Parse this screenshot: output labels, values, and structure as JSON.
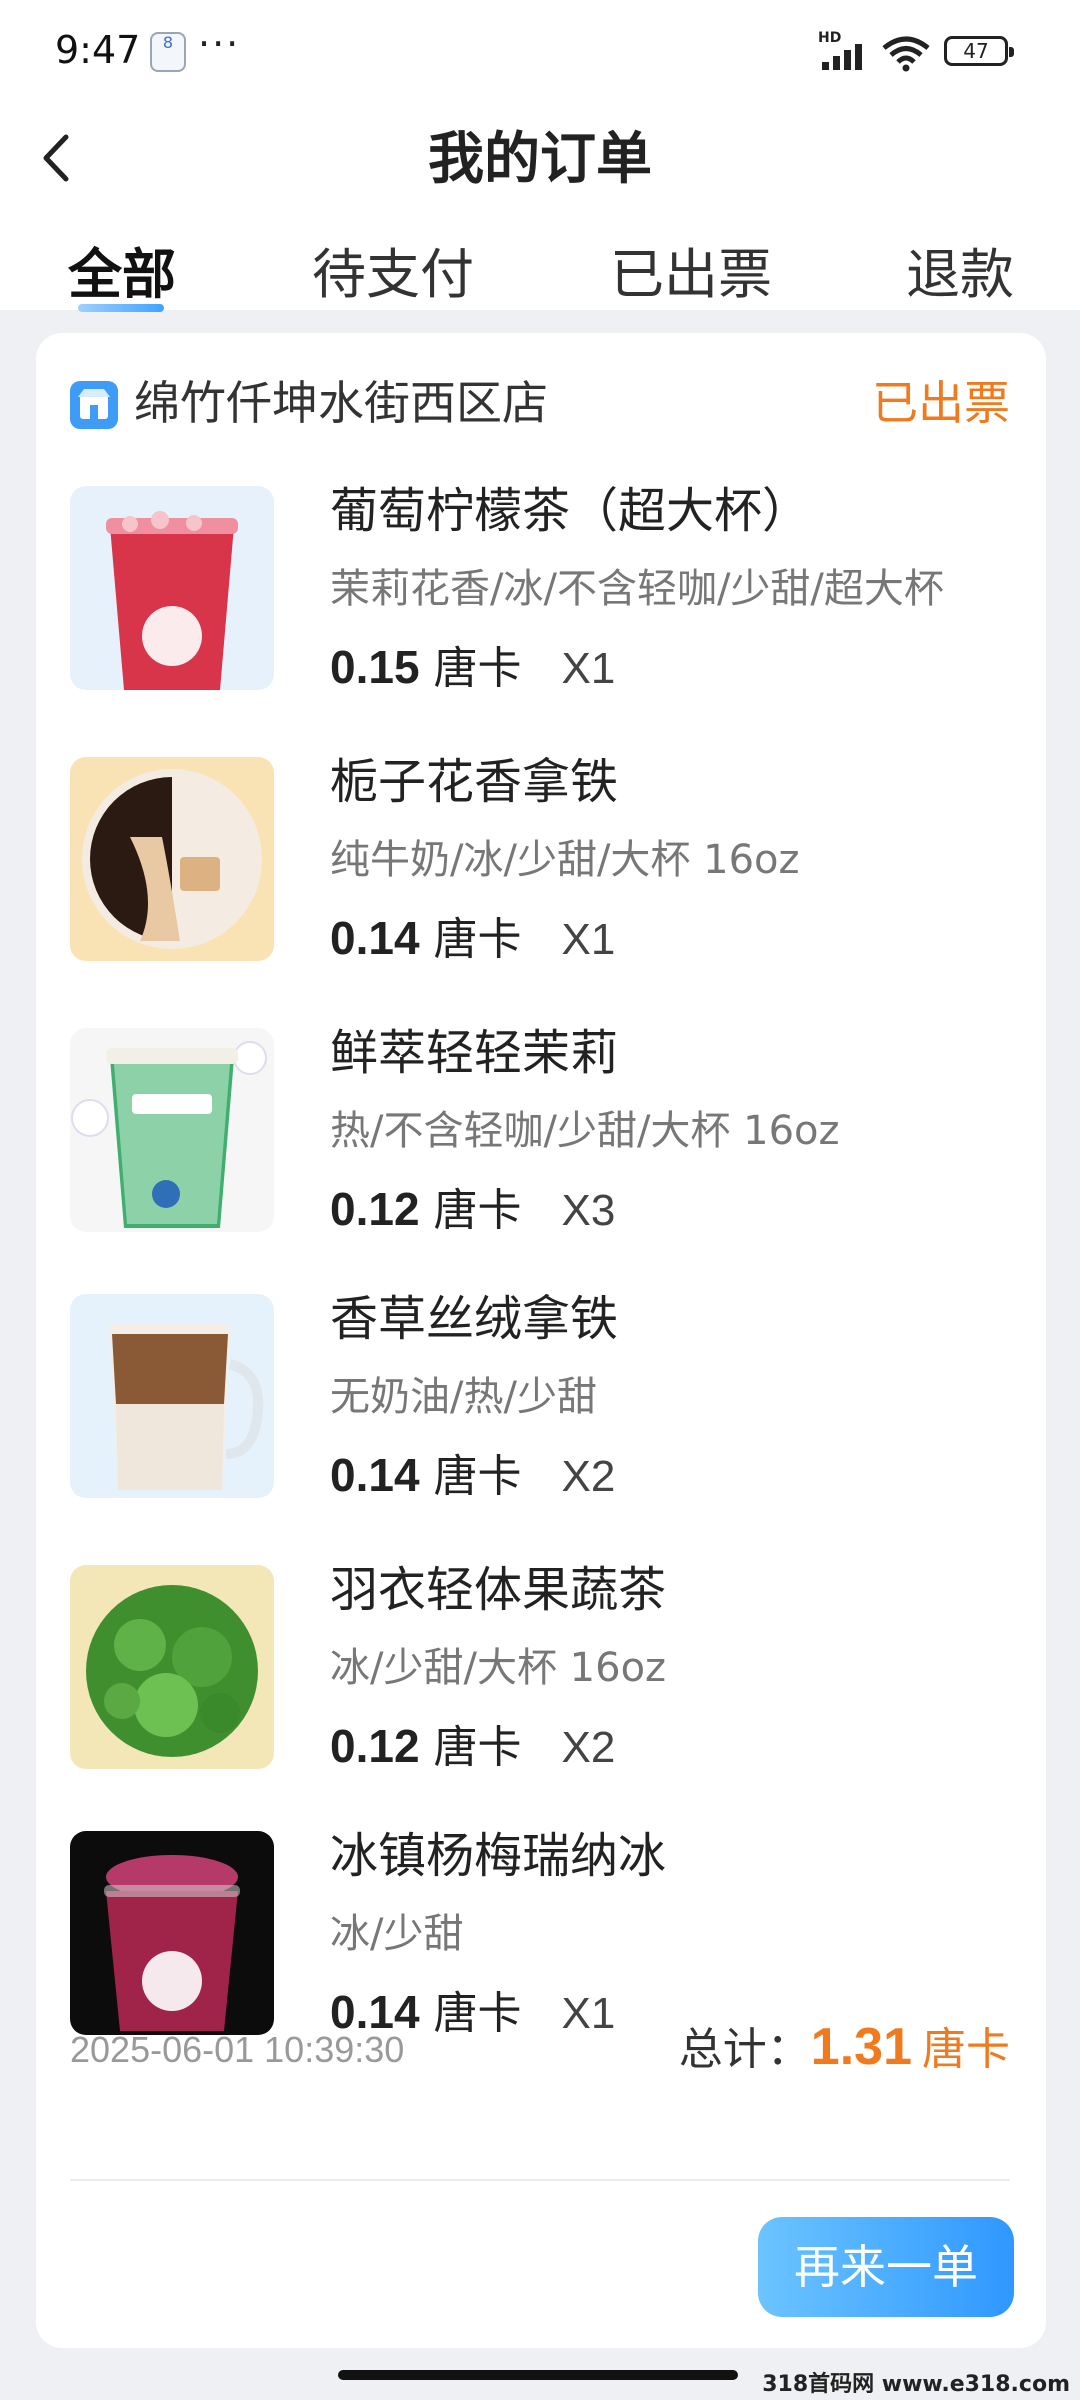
{
  "status_bar": {
    "time": "9:47",
    "notification_badge": "8",
    "more": "···",
    "network": "HD",
    "battery": "47"
  },
  "header": {
    "title": "我的订单"
  },
  "tabs": [
    {
      "label": "全部",
      "active": true
    },
    {
      "label": "待支付",
      "active": false
    },
    {
      "label": "已出票",
      "active": false
    },
    {
      "label": "退款",
      "active": false
    }
  ],
  "order": {
    "store_name": "绵竹仟坤水街西区店",
    "status": "已出票",
    "items": [
      {
        "name": "葡萄柠檬茶（超大杯）",
        "spec": "茉莉花香/冰/不含轻咖/少甜/超大杯",
        "price": "0.15",
        "unit": "唐卡",
        "qty": "X1"
      },
      {
        "name": "栀子花香拿铁",
        "spec": "纯牛奶/冰/少甜/大杯 16oz",
        "price": "0.14",
        "unit": "唐卡",
        "qty": "X1"
      },
      {
        "name": "鲜萃轻轻茉莉",
        "spec": "热/不含轻咖/少甜/大杯 16oz",
        "price": "0.12",
        "unit": "唐卡",
        "qty": "X3"
      },
      {
        "name": "香草丝绒拿铁",
        "spec": "无奶油/热/少甜",
        "price": "0.14",
        "unit": "唐卡",
        "qty": "X2"
      },
      {
        "name": "羽衣轻体果蔬茶",
        "spec": "冰/少甜/大杯 16oz",
        "price": "0.12",
        "unit": "唐卡",
        "qty": "X2"
      },
      {
        "name": "冰镇杨梅瑞纳冰",
        "spec": "冰/少甜",
        "price": "0.14",
        "unit": "唐卡",
        "qty": "X1"
      }
    ],
    "time": "2025-06-01 10:39:30",
    "total_label": "总计：",
    "total_value": "1.31",
    "total_unit": "唐卡",
    "reorder_label": "再来一单"
  },
  "watermark": "318首码网 www.e318.com",
  "colors": {
    "accent_orange": "#f07a1e",
    "accent_blue": "#2f98ff",
    "background": "#eef0f3"
  }
}
